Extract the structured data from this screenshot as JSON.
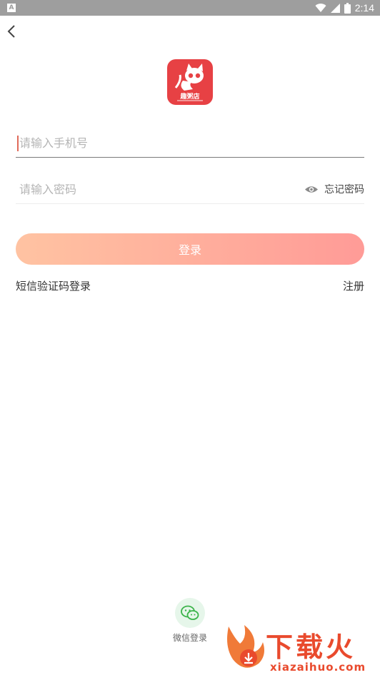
{
  "status_bar": {
    "notification_icon": "a-notification-icon",
    "time": "2:14",
    "icons": [
      "wifi-icon",
      "signal-icon",
      "battery-icon"
    ]
  },
  "header": {
    "back_icon": "back-arrow-icon"
  },
  "logo": {
    "text": "趣粥店",
    "icon": "cat-logo-icon",
    "brand_color": "#e74144"
  },
  "form": {
    "phone_placeholder": "请输入手机号",
    "phone_value": "",
    "password_placeholder": "请输入密码",
    "password_value": "",
    "show_password_icon": "eye-icon",
    "forgot_password": "忘记密码",
    "login_button": "登录",
    "sms_login": "短信验证码登录",
    "register": "注册"
  },
  "social": {
    "wechat_icon": "wechat-icon",
    "wechat_label": "微信登录"
  },
  "watermark": {
    "title": "下载火",
    "url": "xiazaihuo.com"
  },
  "colors": {
    "gradient_start": "#ffc3a2",
    "gradient_end": "#ff9b97",
    "wechat": "#3bb44a",
    "watermark": "#e94a2d"
  }
}
